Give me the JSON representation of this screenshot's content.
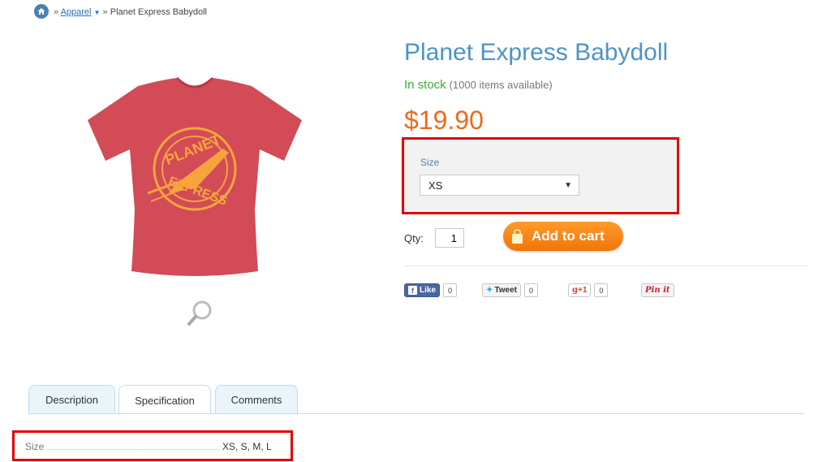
{
  "breadcrumb": {
    "sep": "»",
    "category": "Apparel",
    "current": "Planet Express Babydoll"
  },
  "product": {
    "title": "Planet Express Babydoll",
    "stock_status": "In stock",
    "stock_detail": "(1000 items available)",
    "price": "$19.90",
    "shirt_color": "#d24b57",
    "print_color": "#f5a53b",
    "logo_text_top": "PLANET",
    "logo_text_bottom": "EXPRESS"
  },
  "options": {
    "size_label": "Size",
    "size_selected": "XS"
  },
  "purchase": {
    "qty_label": "Qty:",
    "qty_value": "1",
    "add_to_cart": "Add to cart"
  },
  "social": {
    "like_label": "Like",
    "like_count": "0",
    "tweet_label": "Tweet",
    "tweet_count": "0",
    "gplus_label": "+1",
    "gplus_count": "0",
    "pin_label": "Pin it"
  },
  "tabs": [
    {
      "label": "Description"
    },
    {
      "label": "Specification"
    },
    {
      "label": "Comments"
    }
  ],
  "spec": {
    "name": "Size",
    "value": "XS, S, M, L"
  },
  "colors": {
    "title": "#4d93c9",
    "price": "#ef6a1b",
    "in_stock": "#3fa93a",
    "cart_button": "#f7860f",
    "highlight": "#e00000"
  }
}
